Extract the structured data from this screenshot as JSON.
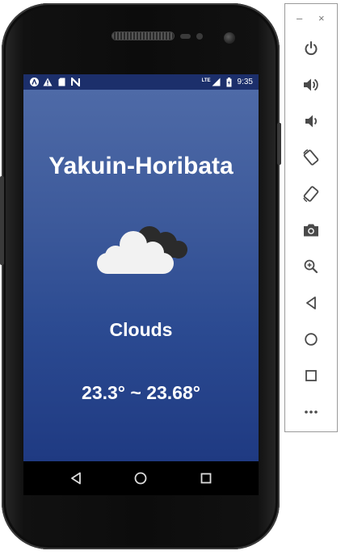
{
  "status_bar": {
    "notifications": [
      "a-circle-icon",
      "warning-icon",
      "sd-card-icon",
      "n-icon"
    ],
    "network_label": "LTE",
    "time": "9:35"
  },
  "weather": {
    "city": "Yakuin-Horibata",
    "icon": "clouds-icon",
    "condition": "Clouds",
    "temperature_range": "23.3° ~ 23.68°"
  },
  "colors": {
    "app_gradient_top": "#4e6aa7",
    "app_gradient_bottom": "#1f3a82",
    "status_bar": "#1c2f6b",
    "toolbar_icon": "#4a4a4a"
  },
  "nav_bar": {
    "buttons": [
      "back",
      "home",
      "recents"
    ]
  },
  "emulator_toolbar": {
    "window_controls": {
      "minimize": "–",
      "close": "×"
    },
    "buttons": [
      "power",
      "volume-up",
      "volume-down",
      "rotate-left",
      "rotate-right",
      "screenshot",
      "zoom",
      "back",
      "home",
      "overview",
      "more"
    ]
  }
}
